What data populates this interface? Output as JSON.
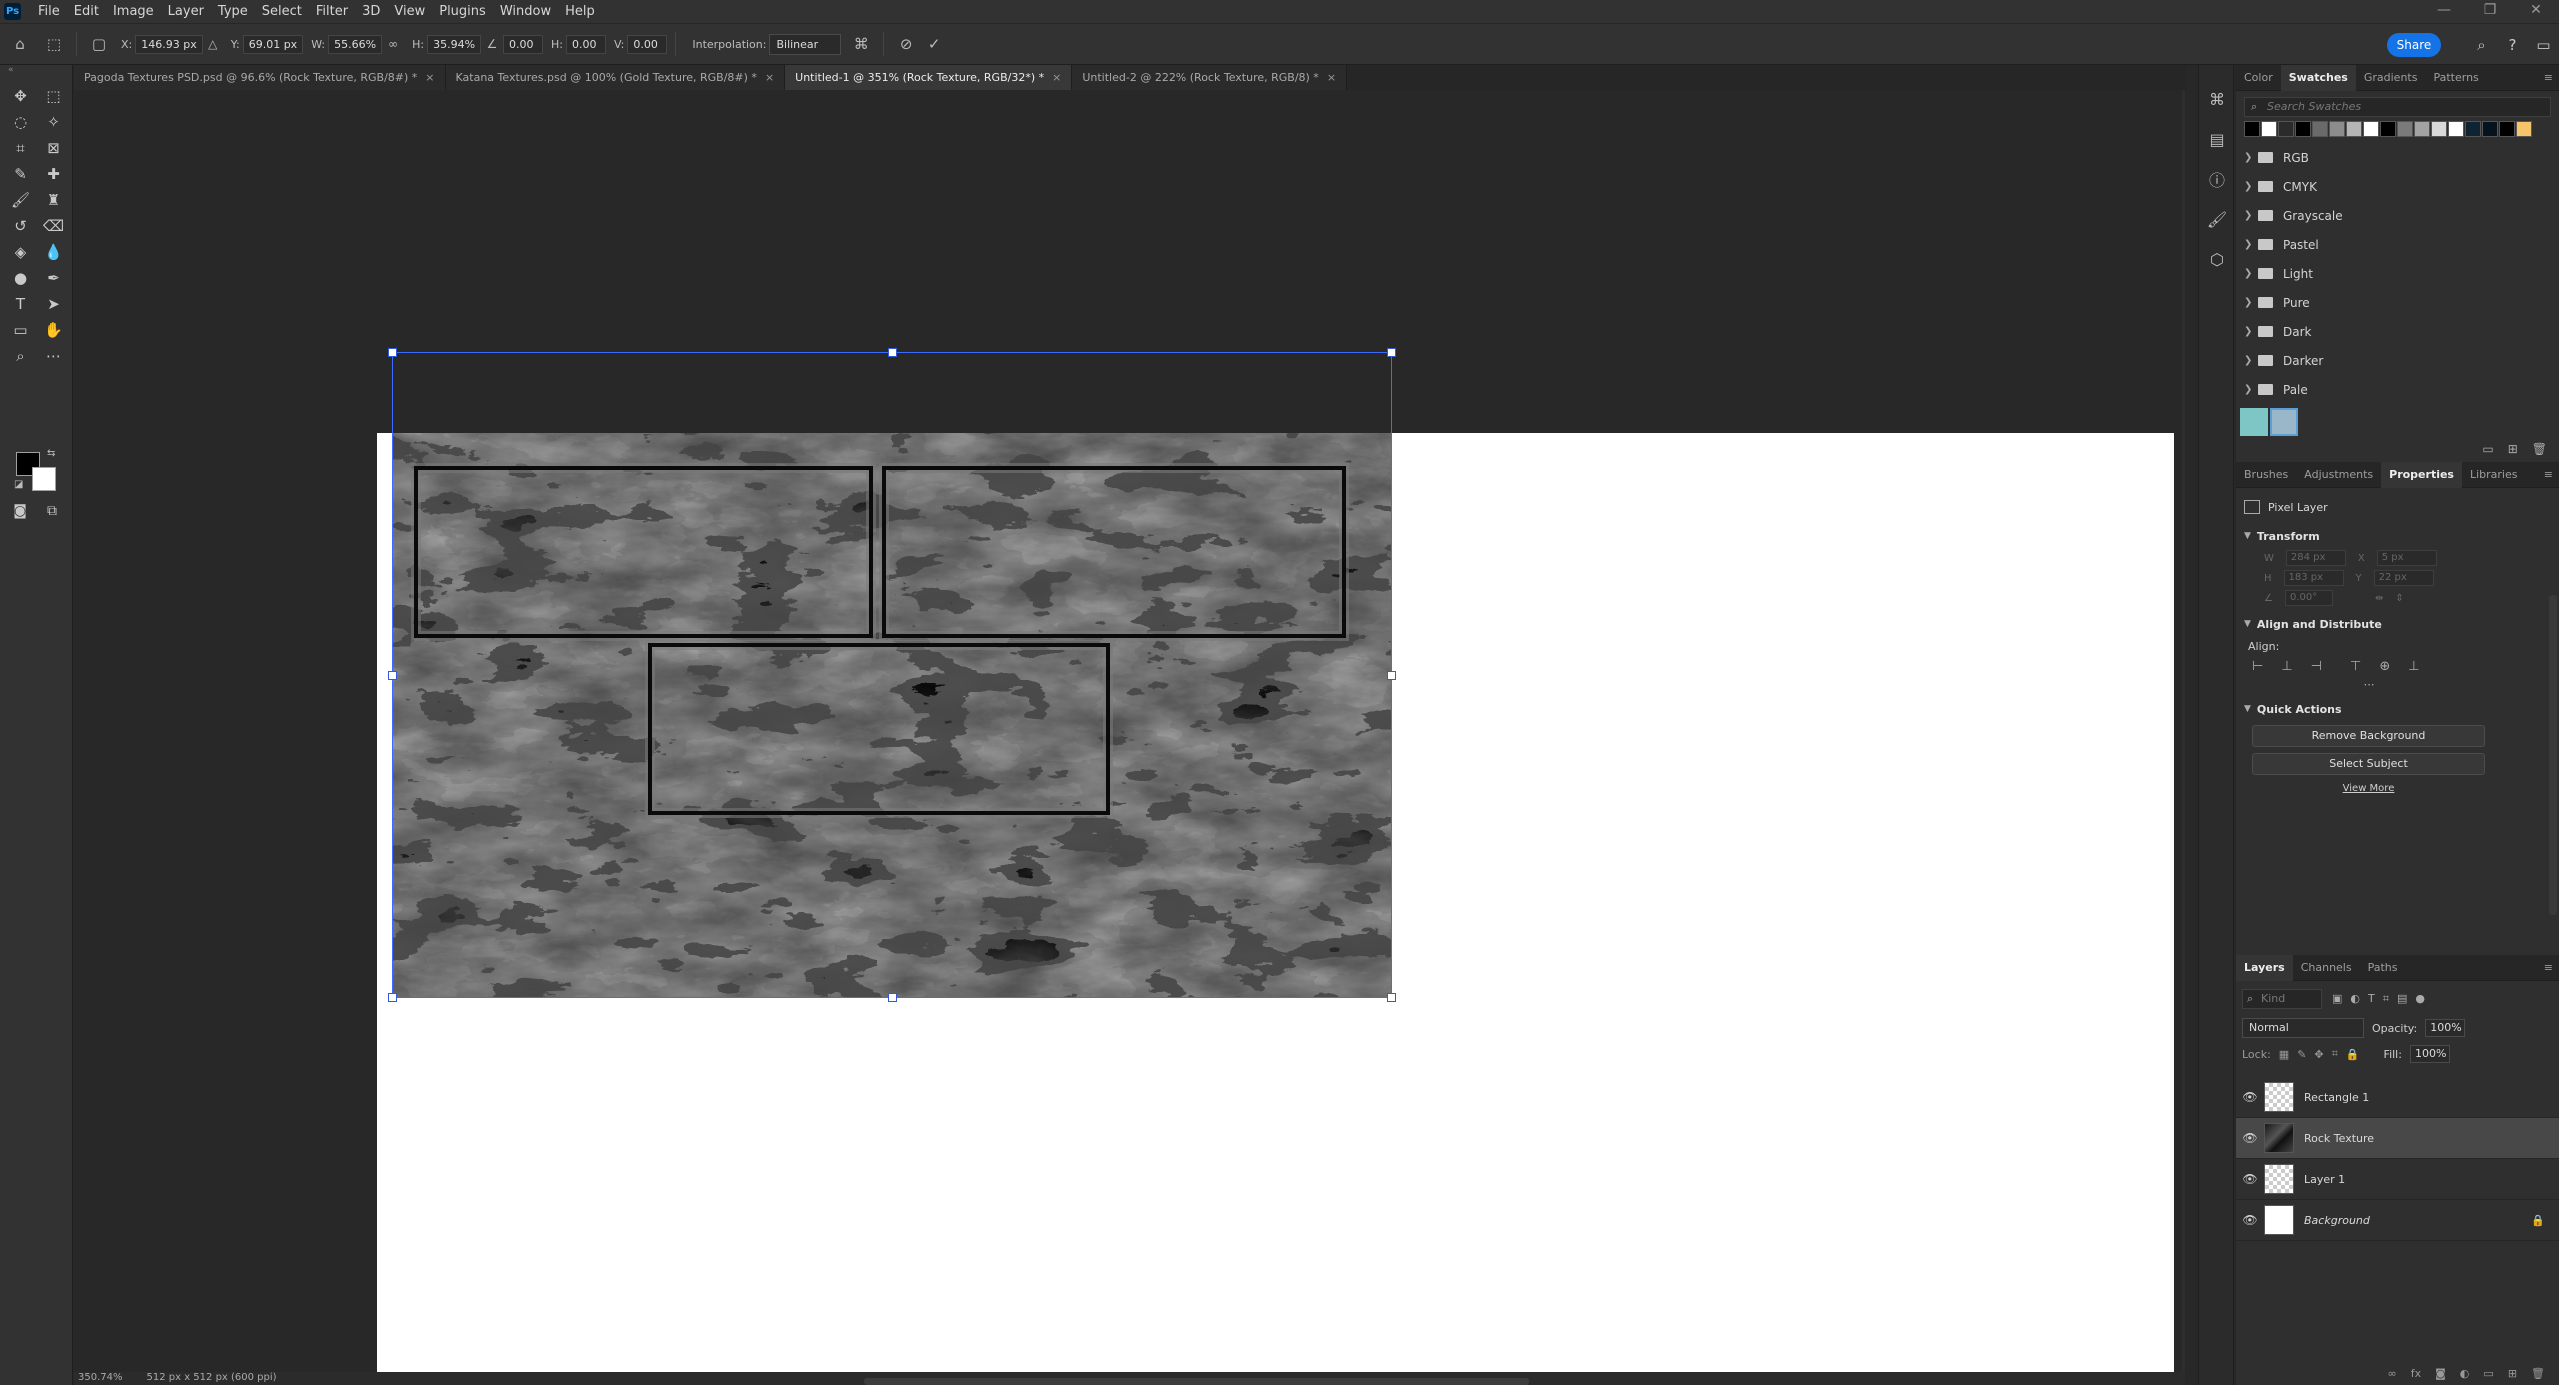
{
  "menu": [
    "File",
    "Edit",
    "Image",
    "Layer",
    "Type",
    "Select",
    "Filter",
    "3D",
    "View",
    "Plugins",
    "Window",
    "Help"
  ],
  "window_controls": [
    "—",
    "❐",
    "✕"
  ],
  "options": {
    "x_label": "X:",
    "x_value": "146.93 px",
    "y_label": "Y:",
    "y_value": "69.01 px",
    "w_label": "W:",
    "w_value": "55.66%",
    "h_label": "H:",
    "h_value": "35.94%",
    "angle_value": "0.00",
    "hskew_label": "H:",
    "hskew_value": "0.00",
    "vskew_label": "V:",
    "vskew_value": "0.00",
    "interp_label": "Interpolation:",
    "interp_value": "Bilinear",
    "share_label": "Share"
  },
  "tabs": [
    {
      "title": "Pagoda Textures PSD.psd @ 96.6% (Rock Texture, RGB/8#) *"
    },
    {
      "title": "Katana Textures.psd @ 100% (Gold Texture, RGB/8#) *"
    },
    {
      "title": "Untitled-1 @ 351% (Rock Texture, RGB/32*) *"
    },
    {
      "title": "Untitled-2 @ 222% (Rock Texture, RGB/8) *"
    }
  ],
  "status": {
    "zoom": "350.74%",
    "doc_size": "512 px x 512 px (600 ppi)"
  },
  "swatches_panel": {
    "tabs": [
      "Color",
      "Swatches",
      "Gradients",
      "Patterns"
    ],
    "search_placeholder": "Search Swatches",
    "colors": [
      "#000000",
      "#ffffff",
      "#2b2b2b",
      "#000000",
      "#6a6a6a",
      "#8c8c8c",
      "#b5b5b5",
      "#ffffff",
      "#000000",
      "#7a7a7a",
      "#a3a3a3",
      "#d9d9d9",
      "#ffffff",
      "#0e2433",
      "#06131c",
      "#000000",
      "#f6c56b"
    ],
    "folders": [
      "RGB",
      "CMYK",
      "Grayscale",
      "Pastel",
      "Light",
      "Pure",
      "Dark",
      "Darker",
      "Pale"
    ],
    "recent": [
      "#7ec6c6",
      "#9ab7c9"
    ]
  },
  "properties_panel": {
    "tabs": [
      "Brushes",
      "Adjustments",
      "Properties",
      "Libraries"
    ],
    "layer_type": "Pixel Layer",
    "transform_title": "Transform",
    "w_label": "W",
    "w_value": "284 px",
    "x_label": "X",
    "x_value": "5 px",
    "h_label": "H",
    "h_value": "183 px",
    "y_label": "Y",
    "y_value": "22 px",
    "angle_value": "0.00°",
    "align_title": "Align and Distribute",
    "align_label": "Align:",
    "quick_title": "Quick Actions",
    "remove_bg": "Remove Background",
    "select_subject": "Select Subject",
    "view_more": "View More"
  },
  "layers_panel": {
    "tabs": [
      "Layers",
      "Channels",
      "Paths"
    ],
    "kind_placeholder": "Kind",
    "blend_mode": "Normal",
    "opacity_label": "Opacity:",
    "opacity_value": "100%",
    "lock_label": "Lock:",
    "fill_label": "Fill:",
    "fill_value": "100%",
    "layers": [
      {
        "name": "Rectangle 1"
      },
      {
        "name": "Rock Texture"
      },
      {
        "name": "Layer 1"
      },
      {
        "name": "Background"
      }
    ]
  }
}
